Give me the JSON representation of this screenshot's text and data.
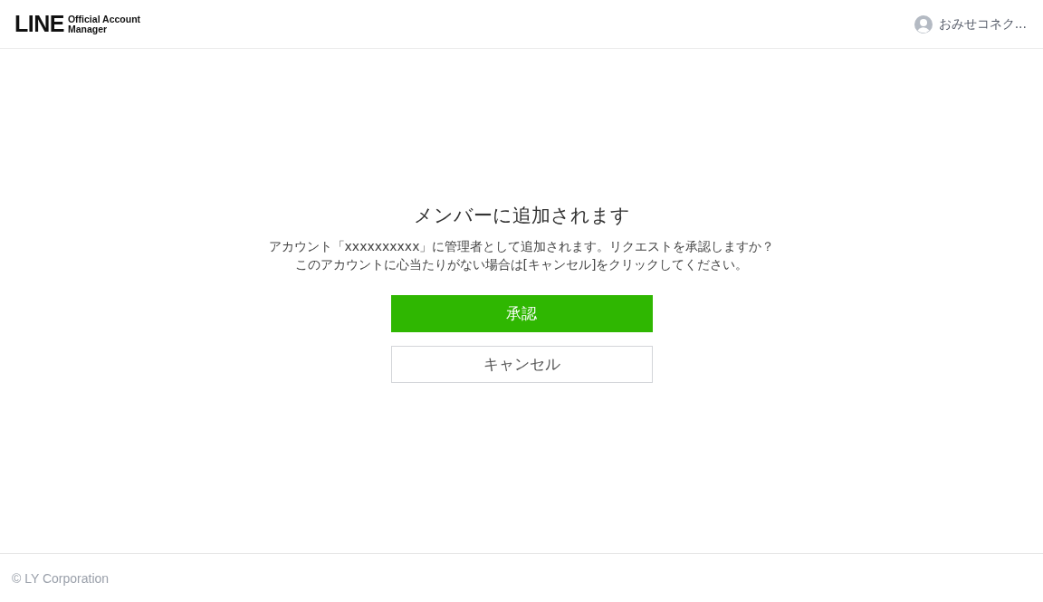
{
  "header": {
    "logo": {
      "wordmark": "LINE",
      "line_1": "Official Account",
      "line_2": "Manager"
    },
    "account": {
      "name": "おみせコネク..."
    }
  },
  "dialog": {
    "title": "メンバーに追加されます",
    "message_lines": [
      "アカウント「xxxxxxxxxx」に管理者として追加されます。リクエストを承認しますか？",
      "このアカウントに心当たりがない場合は[キャンセル]をクリックしてください。"
    ],
    "buttons": [
      {
        "label": "承認",
        "kind": "primary"
      },
      {
        "label": "キャンセル",
        "kind": "secondary"
      }
    ]
  },
  "footer": {
    "copyright": "© LY Corporation"
  }
}
